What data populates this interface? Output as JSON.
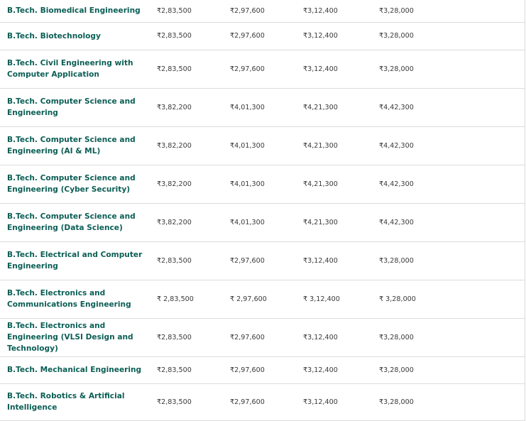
{
  "fee_table": {
    "rows": [
      {
        "course": "B.Tech. Biomedical Engineering",
        "fees": [
          "₹2,83,500",
          "₹2,97,600",
          "₹3,12,400",
          "₹3,28,000"
        ]
      },
      {
        "course": "B.Tech. Biotechnology",
        "fees": [
          "₹2,83,500",
          "₹2,97,600",
          "₹3,12,400",
          "₹3,28,000"
        ]
      },
      {
        "course": "B.Tech. Civil Engineering with Computer Application",
        "fees": [
          "₹2,83,500",
          "₹2,97,600",
          "₹3,12,400",
          "₹3,28,000"
        ]
      },
      {
        "course": "B.Tech. Computer Science and Engineering",
        "fees": [
          "₹3,82,200",
          "₹4,01,300",
          "₹4,21,300",
          "₹4,42,300"
        ]
      },
      {
        "course": "B.Tech. Computer Science and Engineering (AI & ML)",
        "fees": [
          "₹3,82,200",
          "₹4,01,300",
          "₹4,21,300",
          "₹4,42,300"
        ]
      },
      {
        "course": "B.Tech. Computer Science and Engineering (Cyber Security)",
        "fees": [
          "₹3,82,200",
          "₹4,01,300",
          "₹4,21,300",
          "₹4,42,300"
        ]
      },
      {
        "course": "B.Tech. Computer Science and Engineering (Data Science)",
        "fees": [
          "₹3,82,200",
          "₹4,01,300",
          "₹4,21,300",
          "₹4,42,300"
        ]
      },
      {
        "course": "B.Tech. Electrical and Computer Engineering",
        "fees": [
          "₹2,83,500",
          "₹2,97,600",
          "₹3,12,400",
          "₹3,28,000"
        ]
      },
      {
        "course": "B.Tech. Electronics and Communications Engineering",
        "fees": [
          "₹ 2,83,500",
          "₹ 2,97,600",
          "₹ 3,12,400",
          "₹ 3,28,000"
        ]
      },
      {
        "course": "B.Tech. Electronics and Engineering (VLSI Design and Technology)",
        "fees": [
          "₹2,83,500",
          "₹2,97,600",
          "₹3,12,400",
          "₹3,28,000"
        ]
      },
      {
        "course": "B.Tech. Mechanical Engineering",
        "fees": [
          "₹2,83,500",
          "₹2,97,600",
          "₹3,12,400",
          "₹3,28,000"
        ]
      },
      {
        "course": "B.Tech. Robotics & Artificial Intelligence",
        "fees": [
          "₹2,83,500",
          "₹2,97,600",
          "₹3,12,400",
          "₹3,28,000"
        ]
      }
    ]
  },
  "colors": {
    "course_text": "#0b5e55",
    "fee_text": "#3a3a3a",
    "row_border": "#dcdcdc"
  }
}
